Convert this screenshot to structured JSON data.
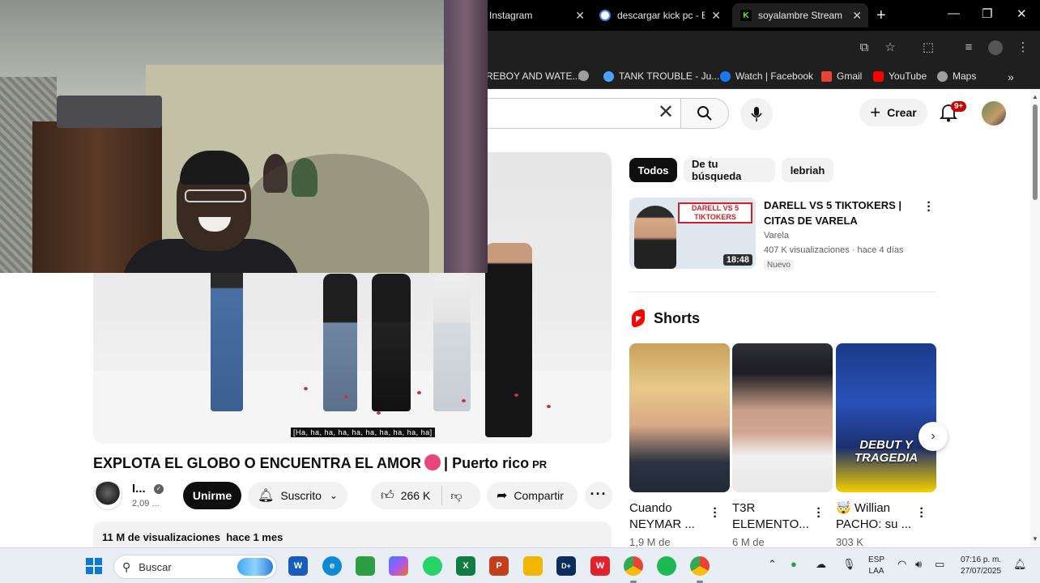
{
  "browser": {
    "tabs": [
      {
        "title": "Instagram",
        "favicon_color": "#000000"
      },
      {
        "title": "descargar kick pc - B",
        "favicon_color": "#ffffff"
      },
      {
        "title": "soyalambre Stream -",
        "favicon_color": "#53fc18",
        "favicon_letter": "K"
      }
    ],
    "new_tab": "+",
    "window_controls": {
      "minimize": "—",
      "maximize": "❐",
      "close": "✕"
    }
  },
  "bookmarks": [
    {
      "label": "REBOY AND WATE...",
      "icon_color": "#e0e0e0"
    },
    {
      "label": "",
      "icon_color": "#9e9e9e"
    },
    {
      "label": "TANK TROUBLE - Ju...",
      "icon_color": "#4aa3ff"
    },
    {
      "label": "Watch | Facebook",
      "icon_color": "#1877f2"
    },
    {
      "label": "Gmail",
      "icon_color": "#ea4335"
    },
    {
      "label": "YouTube",
      "icon_color": "#ff0000"
    },
    {
      "label": "Maps",
      "icon_color": "#9e9e9e"
    }
  ],
  "youtube": {
    "header": {
      "create_label": "Crear",
      "notifications_badge": "9+"
    },
    "video": {
      "title": "EXPLOTA EL GLOBO O ENCUENTRA EL AMOR",
      "title_suffix": "| Puerto rico",
      "flag": "PR",
      "subtitle_caption": "[Ha, ha, ha, ha, ha, ha, ha, ha, ha, ha]",
      "channel_name": "I...",
      "channel_subs": "2,09 ...",
      "join_label": "Unirme",
      "subscribed_label": "Suscrito",
      "likes": "266 K",
      "share_label": "Compartir",
      "views": "11 M de visualizaciones",
      "age": "hace 1 mes"
    },
    "chips": [
      "Todos",
      "De tu búsqueda",
      "lebriah"
    ],
    "recommendation": {
      "title": "DARELL VS 5 TIKTOKERS | CITAS DE VARELA",
      "thumb_banner": "DARELL VS 5 TIKTOKERS",
      "channel": "Varela",
      "meta": "407 K visualizaciones · hace 4 días",
      "badge": "Nuevo",
      "duration": "18:48"
    },
    "shorts": {
      "heading": "Shorts",
      "items": [
        {
          "title": "Cuando NEYMAR ...",
          "views": "1,9 M de",
          "thumb_text": ""
        },
        {
          "title": "T3R ELEMENTO...",
          "views": "6 M de",
          "thumb_text": ""
        },
        {
          "title": "🤯 Willian PACHO: su ...",
          "views": "303 K",
          "thumb_text": "DEBUT Y TRAGEDIA"
        }
      ]
    }
  },
  "taskbar": {
    "search_placeholder": "Buscar",
    "apps": [
      {
        "name": "word",
        "color": "#185abd",
        "letter": "W"
      },
      {
        "name": "edge",
        "color": "#0c8ad6",
        "letter": "e"
      },
      {
        "name": "brasil",
        "color": "#2e9e44",
        "letter": ""
      },
      {
        "name": "copilot",
        "color": "#8f5ff5",
        "letter": ""
      },
      {
        "name": "whatsapp",
        "color": "#25d366",
        "letter": ""
      },
      {
        "name": "excel",
        "color": "#107c41",
        "letter": "X"
      },
      {
        "name": "powerpoint",
        "color": "#c43e1c",
        "letter": "P"
      },
      {
        "name": "explorer",
        "color": "#f2b500",
        "letter": ""
      },
      {
        "name": "disney",
        "color": "#0b2d5b",
        "letter": "D+"
      },
      {
        "name": "wps",
        "color": "#e2222b",
        "letter": "W"
      },
      {
        "name": "chrome",
        "color": "#4285f4",
        "letter": ""
      },
      {
        "name": "spotify",
        "color": "#1db954",
        "letter": ""
      },
      {
        "name": "chrome-profile",
        "color": "#4285f4",
        "letter": ""
      }
    ],
    "language_top": "ESP",
    "language_bottom": "LAA",
    "time": "07:16 p. m.",
    "date": "27/07/2025"
  },
  "colors": {
    "youtube_red": "#ff0000",
    "chrome_dark": "#1f1f1f",
    "accent_blue": "#0a78d4"
  }
}
